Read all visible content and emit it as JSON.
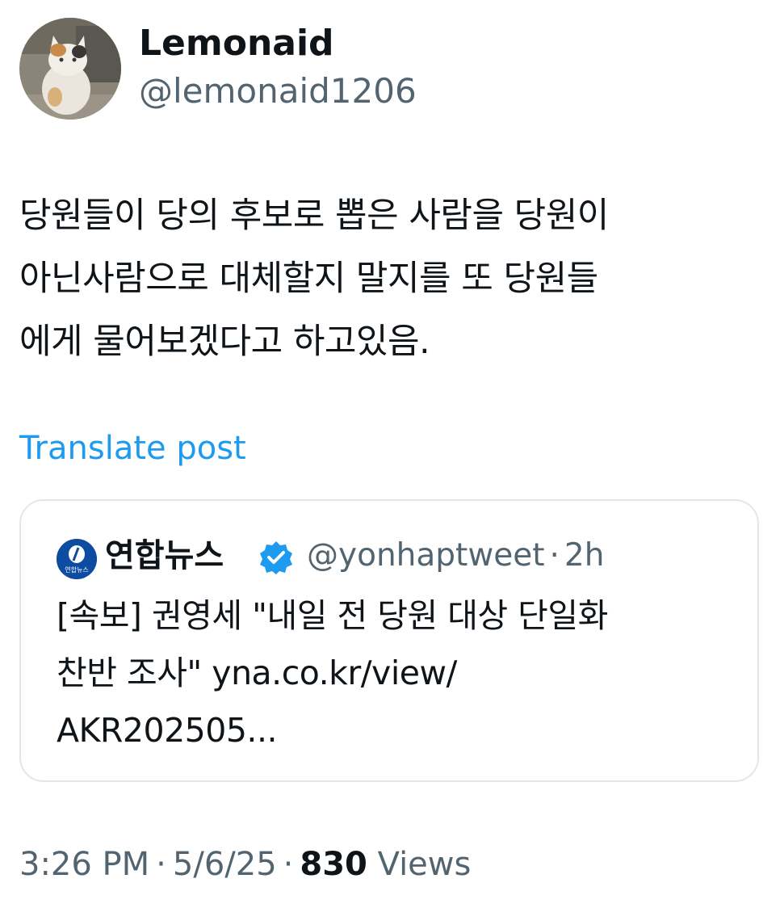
{
  "author": {
    "display_name": "Lemonaid",
    "handle": "@lemonaid1206",
    "avatar_icon": "cat-photo-avatar"
  },
  "tweet": {
    "text": "당원들이 당의 후보로 뽑은 사람을 당원이\n아닌사람으로 대체할지 말지를 또 당원들\n에게 물어보겠다고 하고있음."
  },
  "translate_label": "Translate post",
  "quote": {
    "avatar_icon": "yonhap-news-logo",
    "avatar_text": "연합뉴스",
    "name": "연합뉴스",
    "verified_icon": "verified-badge-icon",
    "handle": "@yonhaptweet",
    "dot": "·",
    "time": "2h",
    "text": "[속보] 권영세 \"내일 전 당원 대상 단일화\n찬반 조사\" yna.co.kr/view/\nAKR202505..."
  },
  "meta": {
    "time": "3:26 PM",
    "date": "5/6/25",
    "separator": "·",
    "views_count": "830",
    "views_label": "Views"
  },
  "colors": {
    "text": "#0f1419",
    "secondary": "#536471",
    "link": "#1d9bf0",
    "verified": "#1d9bf0",
    "card_border": "#e3e7ea"
  }
}
